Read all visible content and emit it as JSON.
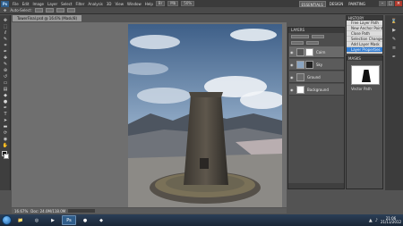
{
  "menubar": {
    "app_logo": "Ps",
    "items": [
      "File",
      "Edit",
      "Image",
      "Layer",
      "Select",
      "Filter",
      "Analysis",
      "3D",
      "View",
      "Window",
      "Help"
    ],
    "buttons": [
      "Br",
      "Mb"
    ],
    "zoom": "50%",
    "workspaces": [
      "ESSENTIALS",
      "DESIGN",
      "PAINTING"
    ],
    "active_workspace": "ESSENTIALS"
  },
  "optionsbar": {
    "label": "Auto-Select:"
  },
  "document": {
    "tab_title": "TowerFinal.psd @ 16.6% (Mask/8)"
  },
  "statusbar": {
    "zoom": "16.67%",
    "doc_size": "Doc: 24.0M/118.0M"
  },
  "layers_panel": {
    "title": "LAYERS",
    "blend_label": "Normal",
    "opacity_label": "Opacity:",
    "fill_label": "Fill:",
    "layers": [
      {
        "name": "Cairn",
        "thumb_color": "#555555"
      },
      {
        "name": "Sky",
        "thumb_color": "#8aa4c0"
      },
      {
        "name": "Ground",
        "thumb_color": "#6a6a6a"
      },
      {
        "name": "Background",
        "thumb_color": "#ffffff"
      }
    ]
  },
  "history_panel": {
    "title": "HISTORY",
    "items": [
      "Free Layer Path",
      "New Anchor Point",
      "Close Path",
      "Selection Change",
      "Add Layer Mask",
      "Layer Properties"
    ],
    "active_index": 5
  },
  "props_panel": {
    "title": "MASKS",
    "label": "Vector Path"
  },
  "taskbar": {
    "time": "21:06",
    "date": "21/11/2012"
  },
  "colors": {
    "accent": "#2f7bd2",
    "workspace_bg": "#535353",
    "taskbar": "#1a2636"
  },
  "icons": {
    "tools": [
      "move-icon",
      "marquee-icon",
      "lasso-icon",
      "quick-select-icon",
      "crop-icon",
      "eyedropper-icon",
      "healing-icon",
      "brush-icon",
      "clone-icon",
      "history-brush-icon",
      "eraser-icon",
      "gradient-icon",
      "blur-icon",
      "dodge-icon",
      "pen-icon",
      "type-icon",
      "path-select-icon",
      "shape-icon",
      "3d-rotate-icon",
      "3d-camera-icon",
      "hand-icon",
      "zoom-icon"
    ]
  }
}
